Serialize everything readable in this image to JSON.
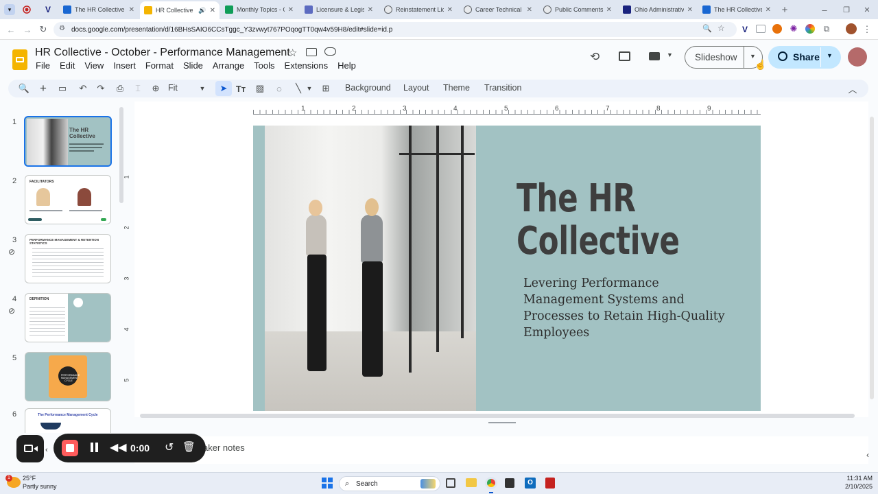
{
  "browser": {
    "tabs": [
      {
        "title": "The HR Collective",
        "icon": "google-sites-icon",
        "color": "#1967d2"
      },
      {
        "title": "HR Collective -",
        "icon": "slides-icon",
        "color": "#f4b400",
        "active": true
      },
      {
        "title": "Monthly Topics - G",
        "icon": "sheets-icon",
        "color": "#0f9d58"
      },
      {
        "title": "Licensure & Legisla",
        "icon": "page-icon",
        "color": "#5c6bc0"
      },
      {
        "title": "Reinstatement Lice",
        "icon": "page-icon",
        "color": "#5f6368"
      },
      {
        "title": "Career Technical W",
        "icon": "page-icon",
        "color": "#5f6368"
      },
      {
        "title": "Public Comments -",
        "icon": "page-icon",
        "color": "#5f6368"
      },
      {
        "title": "Ohio Administrativ",
        "icon": "page-icon",
        "color": "#1a237e"
      },
      {
        "title": "The HR Collective",
        "icon": "google-sites-icon",
        "color": "#1967d2"
      }
    ],
    "url": "docs.google.com/presentation/d/16BHsSAIO6CCsTggc_Y3zvwyt767POqogTT0qw4v59H8/edit#slide=id.p"
  },
  "app": {
    "doc_title": "HR Collective - October - Performance Management",
    "menu": [
      "File",
      "Edit",
      "View",
      "Insert",
      "Format",
      "Slide",
      "Arrange",
      "Tools",
      "Extensions",
      "Help"
    ],
    "slideshow_label": "Slideshow",
    "share_label": "Share"
  },
  "toolbar": {
    "zoom": "Fit",
    "background_label": "Background",
    "layout_label": "Layout",
    "theme_label": "Theme",
    "transition_label": "Transition"
  },
  "ruler": {
    "h": [
      "1",
      "2",
      "3",
      "4",
      "5",
      "6",
      "7",
      "8",
      "9"
    ],
    "v": [
      "1",
      "2",
      "3",
      "4",
      "5"
    ]
  },
  "filmstrip": {
    "slides": [
      {
        "num": "1",
        "title": "The HR Collective"
      },
      {
        "num": "2",
        "title": "FACILITATORS"
      },
      {
        "num": "3",
        "title": "PERFORMANCE MANAGEMENT & RETENTION STATISTICS"
      },
      {
        "num": "4",
        "title": "DEFINITION"
      },
      {
        "num": "5",
        "title": "PERFORMANCE MANAGEMENT CYCLE"
      },
      {
        "num": "6",
        "title": "The Performance Management Cycle"
      }
    ]
  },
  "slide": {
    "title": "The HR Collective",
    "subtitle": "Levering Performance Management Systems and Processes to Retain High-Quality Employees",
    "bg_color": "#a2c2c3",
    "title_color": "#3e3e3e"
  },
  "notes": {
    "label": "aker notes"
  },
  "recorder": {
    "time": "0:00"
  },
  "taskbar": {
    "weather_temp": "25°F",
    "weather_desc": "Partly sunny",
    "search_placeholder": "Search",
    "time": "11:31 AM",
    "date": "2/10/2025",
    "weather_badge": "1"
  }
}
